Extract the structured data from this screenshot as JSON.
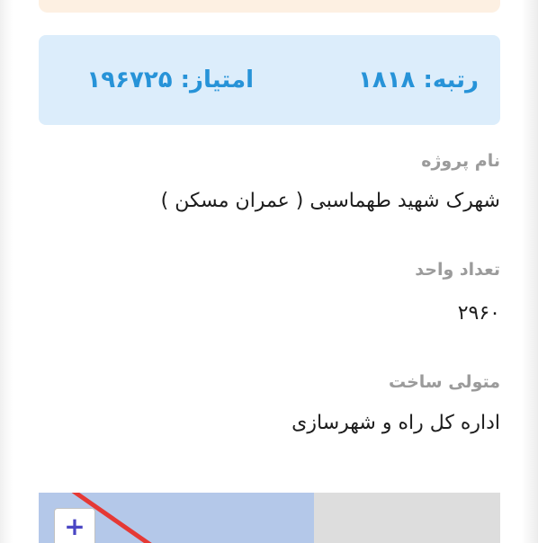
{
  "rank_card": {
    "rank_label": "رتبه: ۱۸۱۸",
    "score_label": "امتیاز: ۱۹۶۷۲۵"
  },
  "fields": [
    {
      "label": "نام پروژه",
      "value": "شهرک شهید طهماسبی ( عمران مسکن )"
    },
    {
      "label": "تعداد واحد",
      "value": "۲۹۶۰"
    },
    {
      "label": "متولی ساخت",
      "value": "اداره کل راه و شهرسازی"
    }
  ],
  "map": {
    "zoom_in_label": "+",
    "colors": {
      "water": "#b4c8e9",
      "land": "#dddddd",
      "road": "#e53935"
    }
  },
  "colors": {
    "accent": "#2793d8",
    "rank_bg": "#dcedfb",
    "top_card_bg": "#fdf0e2",
    "label_gray": "#9b9b9b"
  }
}
